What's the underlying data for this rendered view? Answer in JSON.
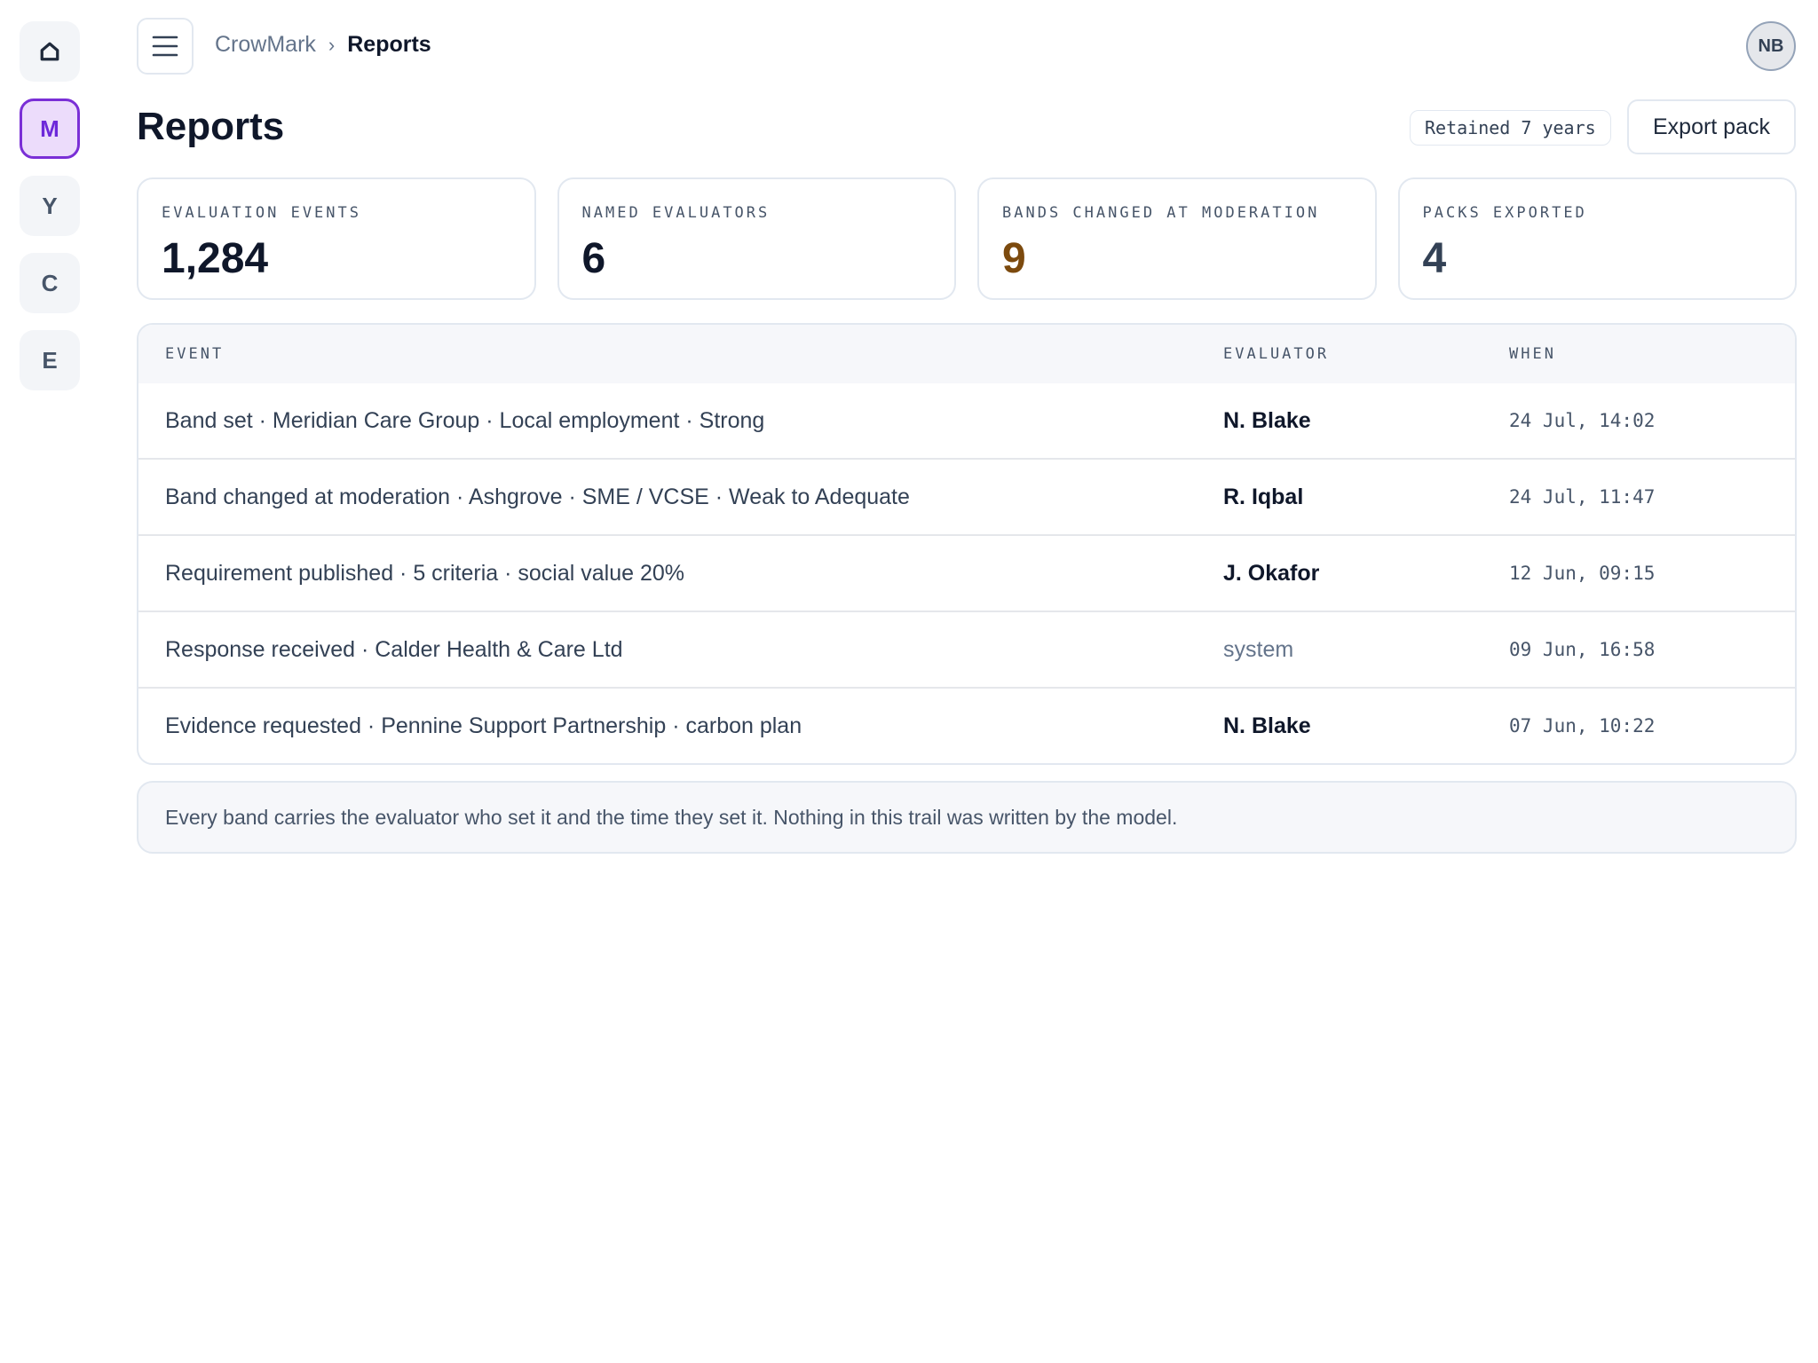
{
  "rail": {
    "items": [
      {
        "icon": "home-icon",
        "label": ""
      },
      {
        "label": "M",
        "active": true
      },
      {
        "label": "Y"
      },
      {
        "label": "C"
      },
      {
        "label": "E"
      }
    ]
  },
  "breadcrumb": {
    "root": "CrowMark",
    "separator": "›",
    "current": "Reports"
  },
  "user": {
    "initials": "NB"
  },
  "header": {
    "title": "Reports",
    "retention": "Retained 7 years",
    "export_label": "Export pack"
  },
  "stats": [
    {
      "label": "EVALUATION EVENTS",
      "value": "1,284"
    },
    {
      "label": "NAMED EVALUATORS",
      "value": "6"
    },
    {
      "label": "BANDS CHANGED AT MODERATION",
      "value": "9"
    },
    {
      "label": "PACKS EXPORTED",
      "value": "4"
    }
  ],
  "table": {
    "columns": [
      "EVENT",
      "EVALUATOR",
      "WHEN"
    ],
    "rows": [
      {
        "event": "Band set · Meridian Care Group · Local employment · Strong",
        "evaluator": "N. Blake",
        "when": "24 Jul, 14:02"
      },
      {
        "event": "Band changed at moderation · Ashgrove · SME / VCSE · Weak to Adequate",
        "evaluator": "R. Iqbal",
        "when": "24 Jul, 11:47"
      },
      {
        "event": "Requirement published · 5 criteria · social value 20%",
        "evaluator": "J. Okafor",
        "when": "12 Jun, 09:15"
      },
      {
        "event": "Response received · Calder Health & Care Ltd",
        "evaluator": "system",
        "when": "09 Jun, 16:58"
      },
      {
        "event": "Evidence requested · Pennine Support Partnership · carbon plan",
        "evaluator": "N. Blake",
        "when": "07 Jun, 10:22"
      }
    ]
  },
  "note": "Every band carries the evaluator who set it and the time they set it. Nothing in this trail was written by the model.",
  "colors": {
    "accent": "#7a2fd6",
    "warning_value": "#7c4a0e"
  }
}
